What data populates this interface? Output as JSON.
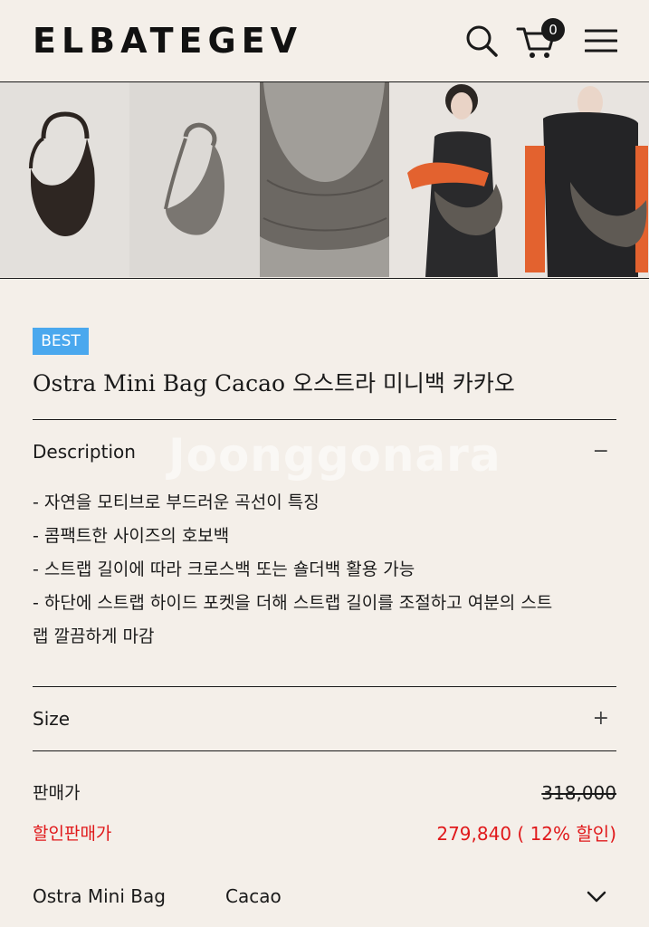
{
  "header": {
    "logo": "ELBATEGEV",
    "cart_count": "0",
    "icons": [
      "search-icon",
      "cart-icon",
      "menu-icon"
    ]
  },
  "gallery": {
    "thumbnails": [
      "bag-front",
      "bag-side",
      "bag-closeup",
      "model-wearing-bag"
    ]
  },
  "product": {
    "badge": "BEST",
    "title": "Ostra Mini Bag Cacao 오스트라 미니백 카카오"
  },
  "description": {
    "label": "Description",
    "toggle": "−",
    "lines": [
      "- 자연을 모티브로 부드러운 곡선이 특징",
      "- 콤팩트한 사이즈의 호보백",
      "- 스트랩 길이에 따라 크로스백 또는 숄더백 활용 가능",
      "- 하단에 스트랩 하이드 포켓을 더해 스트랩 길이를 조절하고 여분의 스트",
      "랩 깔끔하게 마감"
    ]
  },
  "size": {
    "label": "Size",
    "toggle": "+"
  },
  "pricing": {
    "price_label": "판매가",
    "price_value": "318,000",
    "sale_label": "할인판매가",
    "sale_value": "279,840 ( 12% 할인)"
  },
  "option": {
    "name": "Ostra Mini Bag",
    "value": "Cacao"
  },
  "watermark": "Joonggonara",
  "colors": {
    "background": "#f4efe9",
    "badge": "#4aa8ee",
    "sale_red": "#e0191b",
    "bag": "#5f5a54"
  }
}
